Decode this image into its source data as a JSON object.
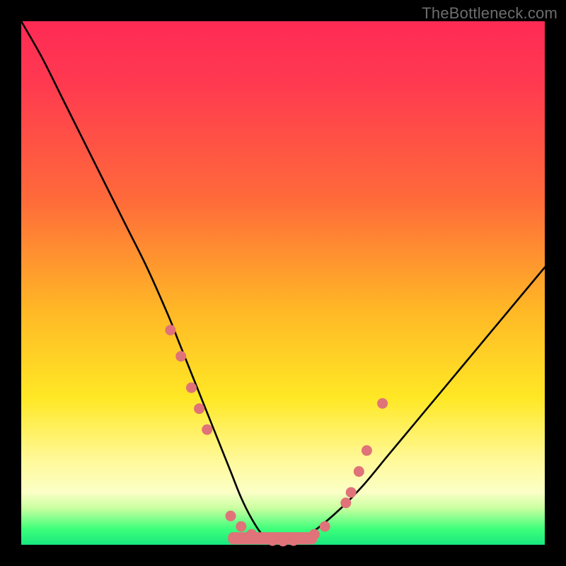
{
  "watermark": "TheBottleneck.com",
  "chart_data": {
    "type": "line",
    "title": "",
    "xlabel": "",
    "ylabel": "",
    "xlim": [
      0,
      100
    ],
    "ylim": [
      0,
      100
    ],
    "series": [
      {
        "name": "bottleneck-curve",
        "x": [
          0,
          4,
          8,
          12,
          16,
          20,
          24,
          28,
          30,
          32,
          34,
          36,
          38,
          40,
          42,
          44,
          46,
          48,
          50,
          52,
          55,
          60,
          65,
          70,
          75,
          80,
          85,
          90,
          95,
          100
        ],
        "values": [
          100,
          93,
          85,
          77,
          69,
          61,
          53,
          44,
          39,
          34,
          29,
          24,
          19,
          14,
          9,
          5,
          2,
          0.8,
          0.5,
          0.7,
          2,
          6,
          11,
          17,
          23,
          29,
          35,
          41,
          47,
          53
        ]
      }
    ],
    "markers": {
      "name": "data-points",
      "color": "#e07279",
      "x": [
        28.5,
        30.5,
        32.5,
        34,
        35.5,
        40,
        42,
        44,
        46,
        48,
        50,
        52,
        54,
        56,
        58,
        62,
        63,
        64.5,
        66,
        69
      ],
      "values": [
        41,
        36,
        30,
        26,
        22,
        5.5,
        3.5,
        2,
        1.2,
        0.8,
        0.7,
        0.8,
        1.2,
        2,
        3.5,
        8,
        10,
        14,
        18,
        27
      ]
    },
    "bottom_band": {
      "name": "optimal-zone",
      "color": "#e07279",
      "x_start": 39.5,
      "x_end": 56.5,
      "y": 0.7,
      "thickness": 2.3
    },
    "gradient_scale": {
      "top": "high-bottleneck",
      "bottom": "no-bottleneck"
    }
  }
}
